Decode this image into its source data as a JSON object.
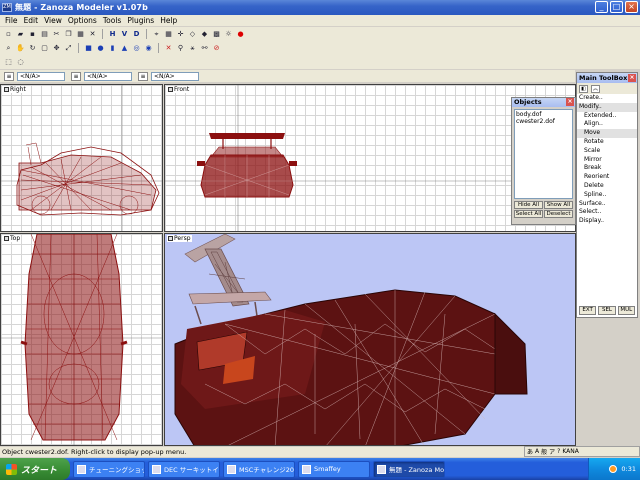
{
  "window": {
    "title": "無題 - Zanoza Modeler v1.07b",
    "icon_label": "ZM",
    "controls": [
      "_",
      "□",
      "×"
    ]
  },
  "menu": [
    "File",
    "Edit",
    "View",
    "Options",
    "Tools",
    "Plugins",
    "Help"
  ],
  "toolbar": {
    "row1_icons": [
      "new-file-icon",
      "open-folder-icon",
      "save-icon",
      "print-icon",
      "cut-icon",
      "copy-icon",
      "paste-icon",
      "delete-icon"
    ],
    "letter_buttons": [
      "H",
      "V",
      "D"
    ],
    "row1_extra_icons": [
      "snap-icon",
      "grid-icon",
      "axis-icon",
      "wireframe-icon",
      "shade-icon",
      "texture-icon",
      "light-icon",
      "record-icon"
    ],
    "row2_icons": [
      "zoom-icon",
      "pan-icon",
      "rotate-view-icon",
      "select-icon",
      "move-icon",
      "scale-icon",
      "cube-icon",
      "sphere-icon",
      "cylinder-icon",
      "cone-icon",
      "torus-icon",
      "tube-icon",
      "figure-icon",
      "figure2-icon",
      "figure3-icon",
      "figure4-icon",
      "no-icon"
    ],
    "row3_icons": [
      "select-box-icon",
      "lasso-icon"
    ]
  },
  "layers": [
    {
      "value": "<N/A>"
    },
    {
      "value": "<N/A>"
    },
    {
      "value": "<N/A>"
    }
  ],
  "viewports": {
    "right": {
      "label": "Right"
    },
    "front": {
      "label": "Front"
    },
    "top": {
      "label": "Top"
    },
    "perspective": {
      "label": "Persp"
    }
  },
  "objects_panel": {
    "title": "Objects",
    "items": [
      "body.dof",
      "cwester2.dof"
    ],
    "buttons": [
      "Hide All",
      "Show All",
      "Select All",
      "Deselect"
    ]
  },
  "toolbox": {
    "title": "Main ToolBox",
    "items": [
      {
        "label": "Create..",
        "sub": false,
        "selected": false
      },
      {
        "label": "Modify..",
        "sub": false,
        "selected": true
      },
      {
        "label": "Extended..",
        "sub": true,
        "selected": false
      },
      {
        "label": "Align..",
        "sub": true,
        "selected": false
      },
      {
        "label": "Move",
        "sub": true,
        "selected": true
      },
      {
        "label": "Rotate",
        "sub": true,
        "selected": false
      },
      {
        "label": "Scale",
        "sub": true,
        "selected": false
      },
      {
        "label": "Mirror",
        "sub": true,
        "selected": false
      },
      {
        "label": "Break",
        "sub": true,
        "selected": false
      },
      {
        "label": "Reorient",
        "sub": true,
        "selected": false
      },
      {
        "label": "Delete",
        "sub": true,
        "selected": false
      },
      {
        "label": "Spline..",
        "sub": true,
        "selected": false
      },
      {
        "label": "Surface..",
        "sub": false,
        "selected": false
      },
      {
        "label": "Select..",
        "sub": false,
        "selected": false
      },
      {
        "label": "Display..",
        "sub": false,
        "selected": false
      }
    ],
    "footer": [
      "EXT",
      "SEL",
      "MUL"
    ]
  },
  "status": {
    "text": "Object cwester2.dof. Right-click to display pop-up menu.",
    "ime": [
      "あ",
      "A",
      "般",
      "ア",
      "?",
      "KANA"
    ]
  },
  "taskbar": {
    "start_label": "スタート",
    "tasks": [
      {
        "label": "チューニングショップ  カ...",
        "active": false
      },
      {
        "label": "DEC サーキットイベント...",
        "active": false
      },
      {
        "label": "MSCチャレンジ2007 耐...",
        "active": false
      },
      {
        "label": "Smaffey",
        "active": false
      },
      {
        "label": "無題 - Zanoza Model...",
        "active": true
      }
    ],
    "clock": "0:31"
  },
  "colors": {
    "mesh": "#8b0f0f",
    "titlebar": "#2a58c0",
    "taskbar": "#245edb",
    "perspective_bg": "#bcc6f5"
  }
}
